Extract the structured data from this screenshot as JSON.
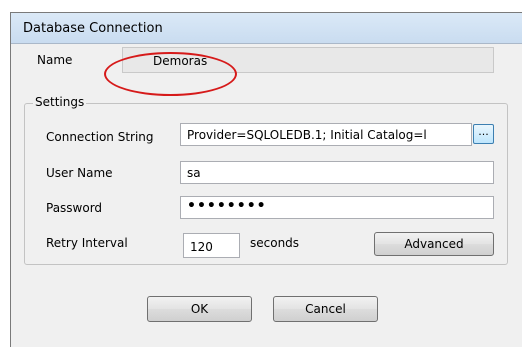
{
  "window": {
    "title": "Database Connection"
  },
  "name": {
    "label": "Name",
    "value": "Demoras"
  },
  "settings": {
    "title": "Settings",
    "connection_string": {
      "label": "Connection String",
      "value": "Provider=SQLOLEDB.1; Initial Catalog=l",
      "browse_label": "..."
    },
    "user_name": {
      "label": "User Name",
      "value": "sa"
    },
    "password": {
      "label": "Password",
      "value": "••••••••"
    },
    "retry_interval": {
      "label": "Retry Interval",
      "value": "120",
      "unit": "seconds"
    },
    "advanced_label": "Advanced"
  },
  "footer": {
    "ok_label": "OK",
    "cancel_label": "Cancel"
  },
  "annotation": {
    "color": "#d61a1a"
  }
}
